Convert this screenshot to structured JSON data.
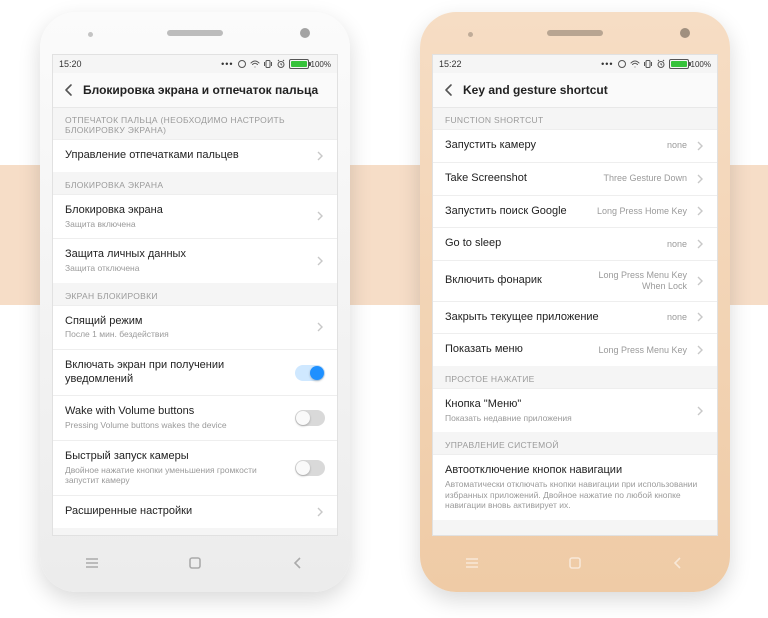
{
  "left": {
    "time": "15:20",
    "battery": "100%",
    "titlebar": "Блокировка экрана и отпечаток пальца",
    "topnote": "ОТПЕЧАТОК ПАЛЬЦА (НЕОБХОДИМО НАСТРОИТЬ БЛОКИРОВКУ ЭКРАНА)",
    "row_fp": "Управление отпечатками пальцев",
    "sect_lock": "БЛОКИРОВКА ЭКРАНА",
    "row_lock_lbl": "Блокировка экрана",
    "row_lock_sub": "Защита включена",
    "row_priv_lbl": "Защита личных данных",
    "row_priv_sub": "Защита отключена",
    "sect_scr": "ЭКРАН БЛОКИРОВКИ",
    "row_sleep_lbl": "Спящий режим",
    "row_sleep_sub": "После 1 мин. бездействия",
    "row_notif": "Включать экран при получении уведомлений",
    "row_vol_lbl": "Wake with Volume buttons",
    "row_vol_sub": "Pressing Volume buttons wakes the device",
    "row_cam_lbl": "Быстрый запуск камеры",
    "row_cam_sub": "Двойное нажатие кнопки уменьшения громкости запустит камеру",
    "row_adv": "Расширенные настройки"
  },
  "right": {
    "time": "15:22",
    "battery": "100%",
    "titlebar": "Key and gesture shortcut",
    "sect_func": "FUNCTION SHORTCUT",
    "r1_lbl": "Запустить камеру",
    "r1_val": "none",
    "r2_lbl": "Take Screenshot",
    "r2_val": "Three Gesture Down",
    "r3_lbl": "Запустить поиск Google",
    "r3_val": "Long Press Home Key",
    "r4_lbl": "Go to sleep",
    "r4_val": "none",
    "r5_lbl": "Включить фонарик",
    "r5_val": "Long Press Menu Key When Lock",
    "r6_lbl": "Закрыть текущее приложение",
    "r6_val": "none",
    "r7_lbl": "Показать меню",
    "r7_val": "Long Press Menu Key",
    "sect_tap": "ПРОСТОЕ НАЖАТИЕ",
    "r8_lbl": "Кнопка \"Меню\"",
    "r8_sub": "Показать недавние приложения",
    "sect_sys": "УПРАВЛЕНИЕ СИСТЕМОЙ",
    "r9_lbl": "Автоотключение кнопок навигации",
    "r9_sub": "Автоматически отключать кнопки навигации при использовании избранных приложений. Двойное нажатие по любой кнопке навигации вновь активирует их."
  }
}
